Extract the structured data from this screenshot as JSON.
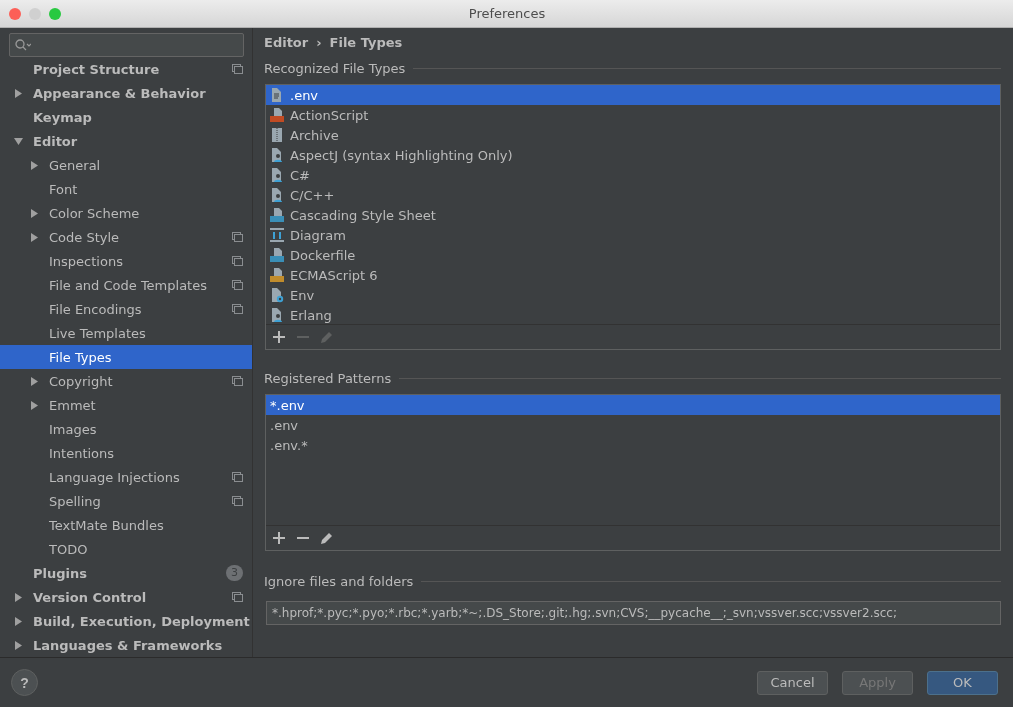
{
  "window": {
    "title": "Preferences"
  },
  "sidebar": {
    "items": [
      {
        "label": "Project Structure",
        "expandable": false,
        "expanded": false,
        "selected": false,
        "shared": true
      },
      {
        "label": "Appearance & Behavior",
        "expandable": true,
        "expanded": false,
        "selected": false,
        "shared": false
      },
      {
        "label": "Keymap",
        "expandable": false,
        "expanded": false,
        "selected": false,
        "shared": false
      },
      {
        "label": "Editor",
        "expandable": true,
        "expanded": true,
        "selected": false,
        "shared": false,
        "children": [
          {
            "label": "General",
            "expandable": true,
            "expanded": false,
            "selected": false,
            "shared": false
          },
          {
            "label": "Font",
            "expandable": false,
            "expanded": false,
            "selected": false,
            "shared": false
          },
          {
            "label": "Color Scheme",
            "expandable": true,
            "expanded": false,
            "selected": false,
            "shared": false
          },
          {
            "label": "Code Style",
            "expandable": true,
            "expanded": false,
            "selected": false,
            "shared": true
          },
          {
            "label": "Inspections",
            "expandable": false,
            "expanded": false,
            "selected": false,
            "shared": true
          },
          {
            "label": "File and Code Templates",
            "expandable": false,
            "expanded": false,
            "selected": false,
            "shared": true
          },
          {
            "label": "File Encodings",
            "expandable": false,
            "expanded": false,
            "selected": false,
            "shared": true
          },
          {
            "label": "Live Templates",
            "expandable": false,
            "expanded": false,
            "selected": false,
            "shared": false
          },
          {
            "label": "File Types",
            "expandable": false,
            "expanded": false,
            "selected": true,
            "shared": false
          },
          {
            "label": "Copyright",
            "expandable": true,
            "expanded": false,
            "selected": false,
            "shared": true
          },
          {
            "label": "Emmet",
            "expandable": true,
            "expanded": false,
            "selected": false,
            "shared": false
          },
          {
            "label": "Images",
            "expandable": false,
            "expanded": false,
            "selected": false,
            "shared": false
          },
          {
            "label": "Intentions",
            "expandable": false,
            "expanded": false,
            "selected": false,
            "shared": false
          },
          {
            "label": "Language Injections",
            "expandable": false,
            "expanded": false,
            "selected": false,
            "shared": true
          },
          {
            "label": "Spelling",
            "expandable": false,
            "expanded": false,
            "selected": false,
            "shared": true
          },
          {
            "label": "TextMate Bundles",
            "expandable": false,
            "expanded": false,
            "selected": false,
            "shared": false
          },
          {
            "label": "TODO",
            "expandable": false,
            "expanded": false,
            "selected": false,
            "shared": false
          }
        ]
      },
      {
        "label": "Plugins",
        "expandable": false,
        "expanded": false,
        "selected": false,
        "shared": false,
        "badge": "3"
      },
      {
        "label": "Version Control",
        "expandable": true,
        "expanded": false,
        "selected": false,
        "shared": true
      },
      {
        "label": "Build, Execution, Deployment",
        "expandable": true,
        "expanded": false,
        "selected": false,
        "shared": false
      },
      {
        "label": "Languages & Frameworks",
        "expandable": true,
        "expanded": false,
        "selected": false,
        "shared": false
      }
    ]
  },
  "breadcrumb": [
    {
      "label": "Editor"
    },
    {
      "label": "File Types"
    }
  ],
  "breadcrumb_separator": "›",
  "recognized_file_types": {
    "title": "Recognized File Types",
    "items": [
      {
        "label": ".env",
        "kind": "text",
        "selected": true
      },
      {
        "label": "ActionScript",
        "kind": "as",
        "selected": false
      },
      {
        "label": "Archive",
        "kind": "archive",
        "selected": false
      },
      {
        "label": "AspectJ (syntax Highlighting Only)",
        "kind": "person",
        "selected": false
      },
      {
        "label": "C#",
        "kind": "person",
        "selected": false
      },
      {
        "label": "C/C++",
        "kind": "person",
        "selected": false
      },
      {
        "label": "Cascading Style Sheet",
        "kind": "css",
        "selected": false
      },
      {
        "label": "Diagram",
        "kind": "diagram",
        "selected": false
      },
      {
        "label": "Dockerfile",
        "kind": "docker",
        "selected": false
      },
      {
        "label": "ECMAScript 6",
        "kind": "js",
        "selected": false
      },
      {
        "label": "Env",
        "kind": "gear",
        "selected": false
      },
      {
        "label": "Erlang",
        "kind": "person",
        "selected": false
      }
    ],
    "toolbar": [
      {
        "kind": "add",
        "disabled": false
      },
      {
        "kind": "remove",
        "disabled": true
      },
      {
        "kind": "edit",
        "disabled": true
      }
    ]
  },
  "registered_patterns": {
    "title": "Registered Patterns",
    "items": [
      {
        "label": "*.env",
        "selected": true
      },
      {
        "label": ".env",
        "selected": false
      },
      {
        "label": ".env.*",
        "selected": false
      }
    ],
    "toolbar": [
      {
        "kind": "add",
        "disabled": false
      },
      {
        "kind": "remove",
        "disabled": false
      },
      {
        "kind": "edit",
        "disabled": false
      }
    ]
  },
  "ignore_files": {
    "title": "Ignore files and folders",
    "value": "*.hprof;*.pyc;*.pyo;*.rbc;*.yarb;*~;.DS_Store;.git;.hg;.svn;CVS;__pycache__;_svn;vssver.scc;vssver2.scc;"
  },
  "help_button": {
    "label": "?"
  },
  "buttons": [
    {
      "label": "Cancel",
      "kind": "normal",
      "disabled": false
    },
    {
      "label": "Apply",
      "kind": "normal",
      "disabled": true
    },
    {
      "label": "OK",
      "kind": "default",
      "disabled": false
    }
  ]
}
